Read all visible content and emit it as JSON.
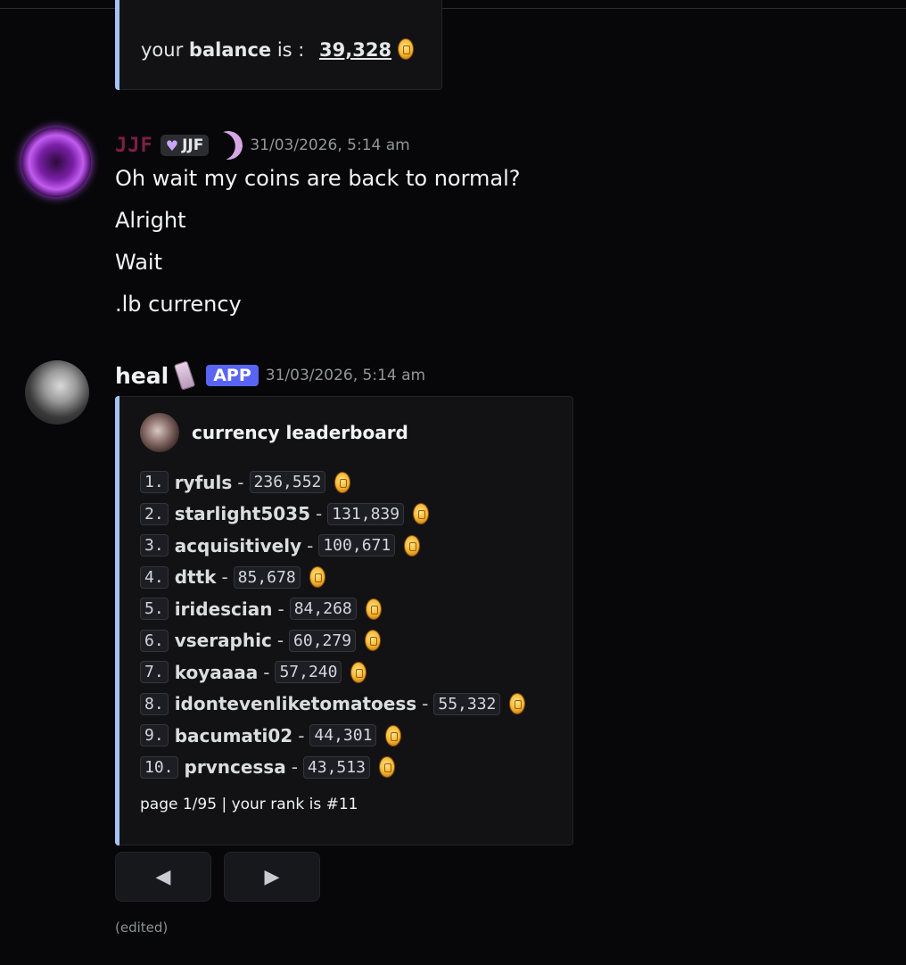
{
  "balance_embed": {
    "prefix": "your",
    "bold_word": "balance",
    "suffix": "is :",
    "amount": "39,328",
    "icon": "coin-icon"
  },
  "message_jjf": {
    "username": "JJF",
    "tag": "JJF",
    "tag_icon": "purple-heart-icon",
    "decoration_icon": "moon-icon",
    "timestamp": "31/03/2026, 5:14 am",
    "lines": [
      "Oh wait my coins are back to normal?",
      "Alright",
      "Wait",
      ".lb currency"
    ]
  },
  "message_heal": {
    "username": "heal",
    "decoration_icon": "phone-icon",
    "badge": "APP",
    "timestamp": "31/03/2026, 5:14 am",
    "embed": {
      "author": "currency leaderboard",
      "rows": [
        {
          "rank": "1.",
          "user": "ryfuls",
          "amount": "236,552"
        },
        {
          "rank": "2.",
          "user": "starlight5035",
          "amount": "131,839"
        },
        {
          "rank": "3.",
          "user": "acquisitively",
          "amount": "100,671"
        },
        {
          "rank": "4.",
          "user": "dttk",
          "amount": "85,678"
        },
        {
          "rank": "5.",
          "user": "iridescian",
          "amount": "84,268"
        },
        {
          "rank": "6.",
          "user": "vseraphic",
          "amount": "60,279"
        },
        {
          "rank": "7.",
          "user": "koyaaaa",
          "amount": "57,240"
        },
        {
          "rank": "8.",
          "user": "idontevenliketomatoess",
          "amount": "55,332"
        },
        {
          "rank": "9.",
          "user": "bacumati02",
          "amount": "44,301"
        },
        {
          "rank": "10.",
          "user": "prvncessa",
          "amount": "43,513"
        }
      ],
      "footer": "page 1/95 | your rank is #11"
    },
    "buttons": {
      "prev": "◀",
      "next": "▶"
    },
    "edited": "(edited)"
  },
  "colors": {
    "background": "#070709",
    "embed_accent": "#a3c3f5",
    "jjf_name": "#7d1f45",
    "app_badge": "#5865f2"
  }
}
